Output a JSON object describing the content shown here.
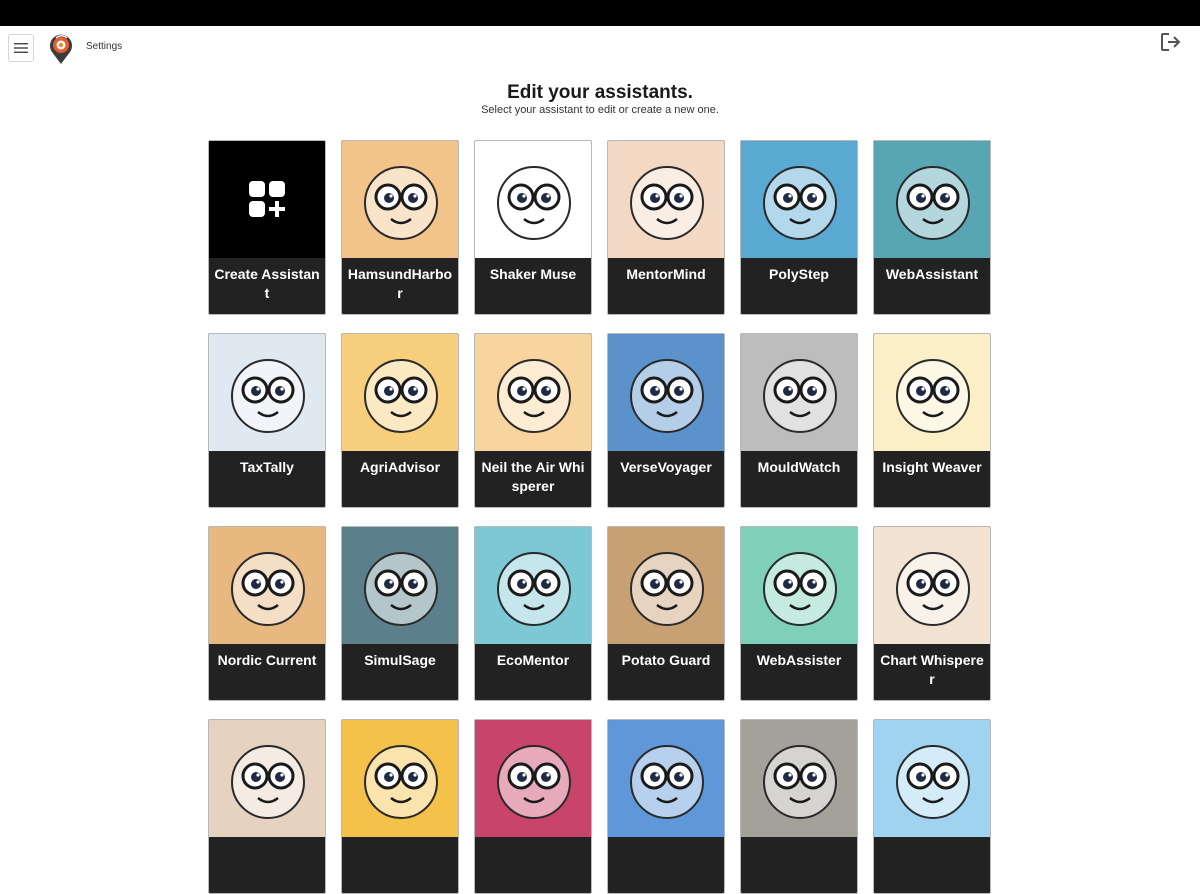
{
  "header": {
    "settings_label": "Settings",
    "menu_icon": "hamburger-icon",
    "logo_icon": "app-logo-icon",
    "logout_icon": "logout-icon"
  },
  "main": {
    "title": "Edit your assistants.",
    "subtitle": "Select your assistant to edit or create a new one."
  },
  "cards": [
    {
      "label": "Create Assistant",
      "bg": "#000000",
      "icon": "grid-plus-icon"
    },
    {
      "label": "HamsundHarbor",
      "bg": "#f2c48a",
      "icon": "owl-books-icon"
    },
    {
      "label": "Shaker Muse",
      "bg": "#ffffff",
      "icon": "owl-feather-icon"
    },
    {
      "label": "MentorMind",
      "bg": "#f3d8c4",
      "icon": "robot-pencil-icon"
    },
    {
      "label": "PolyStep",
      "bg": "#5aa9d2",
      "icon": "shoe-icon"
    },
    {
      "label": "WebAssistant",
      "bg": "#58a6b4",
      "icon": "emoji-glasses-icon"
    },
    {
      "label": "TaxTally",
      "bg": "#dfe9f1",
      "icon": "calculator-icon"
    },
    {
      "label": "AgriAdvisor",
      "bg": "#f7cf7c",
      "icon": "leaf-robot-icon"
    },
    {
      "label": "Neil the Air Whisperer",
      "bg": "#f8d49e",
      "icon": "baby-robot-icon"
    },
    {
      "label": "VerseVoyager",
      "bg": "#5c92cc",
      "icon": "graduate-robot-icon"
    },
    {
      "label": "MouldWatch",
      "bg": "#bdbdbd",
      "icon": "cloud-icon"
    },
    {
      "label": "Insight Weaver",
      "bg": "#fbefc8",
      "icon": "magnifier-robot-icon"
    },
    {
      "label": "Nordic Current",
      "bg": "#e7b981",
      "icon": "lightbulb-icon"
    },
    {
      "label": "SimulSage",
      "bg": "#5b808c",
      "icon": "helmet-robot-icon"
    },
    {
      "label": "EcoMentor",
      "bg": "#7cc8d4",
      "icon": "sun-icon"
    },
    {
      "label": "Potato Guard",
      "bg": "#c7a173",
      "icon": "potato-icon"
    },
    {
      "label": "WebAssister",
      "bg": "#7fd0b8",
      "icon": "clipboard-robot-icon"
    },
    {
      "label": "Chart Whisperer",
      "bg": "#f1e2d2",
      "icon": "chart-glasses-icon"
    },
    {
      "label": "",
      "bg": "#e6d2c0",
      "icon": "camera-lens-icon"
    },
    {
      "label": "",
      "bg": "#f4c14a",
      "icon": "helmet-face-icon"
    },
    {
      "label": "",
      "bg": "#c8446b",
      "icon": "colorful-brain-icon"
    },
    {
      "label": "",
      "bg": "#5f97d8",
      "icon": "bitcoin-owl-icon"
    },
    {
      "label": "",
      "bg": "#a4a19a",
      "icon": "graduate-owl-icon"
    },
    {
      "label": "",
      "bg": "#9fd3f0",
      "icon": "code-robot-icon"
    }
  ]
}
